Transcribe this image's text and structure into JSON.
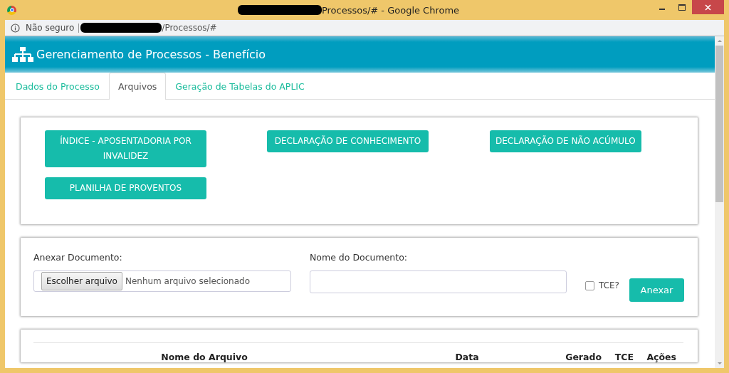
{
  "window": {
    "title": "Processos/# - Google Chrome"
  },
  "address_bar": {
    "security": "Não seguro",
    "url": "/Processos/#"
  },
  "header": {
    "title": "Gerenciamento de Processos - Benefício"
  },
  "tabs": [
    {
      "label": "Dados do Processo",
      "selected": false
    },
    {
      "label": "Arquivos",
      "selected": true
    },
    {
      "label": "Geração de Tabelas do APLIC",
      "selected": false
    }
  ],
  "document_buttons": [
    "ÍNDICE - APOSENTADORIA POR INVALIDEZ",
    "DECLARAÇÃO DE CONHECIMENTO",
    "DECLARAÇÃO DE NÃO ACÚMULO",
    "PLANILHA DE PROVENTOS"
  ],
  "attach_form": {
    "file_label": "Anexar Documento:",
    "file_button": "Escolher arquivo",
    "file_status": "Nenhum arquivo selecionado",
    "name_label": "Nome do Documento:",
    "tce": {
      "label": "TCE?",
      "checked": false
    },
    "submit": "Anexar"
  },
  "table": {
    "columns": [
      "Nome do Arquivo",
      "Data",
      "Gerado",
      "TCE",
      "Ações"
    ]
  }
}
